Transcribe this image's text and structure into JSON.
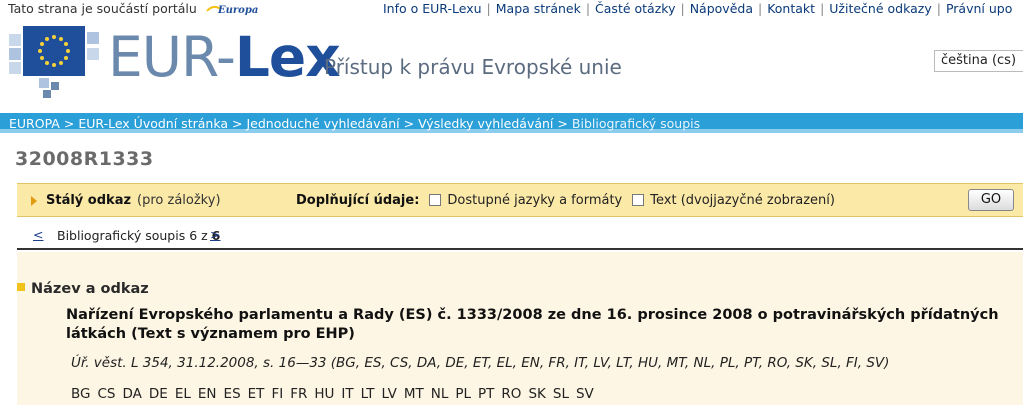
{
  "topbar": {
    "portal_text": "Tato strana je součástí portálu",
    "portal_logo": "Europa",
    "links": [
      "Info o EUR-Lexu",
      "Mapa stránek",
      "Časté otázky",
      "Nápověda",
      "Kontakt",
      "Užitečné odkazy",
      "Právní upo"
    ]
  },
  "header": {
    "logo_eur": "EUR-",
    "logo_lex": "Lex",
    "tagline": "Přístup k právu Evropské unie",
    "language": "čeština (cs)",
    "flag_color": "#1f4f9a",
    "star_color": "#f6d23a"
  },
  "breadcrumb": {
    "items": [
      "EUROPA",
      "EUR-Lex Úvodní stránka",
      "Jednoduché vyhledávání",
      "Výsledky vyhledávání",
      "Bibliografický soupis"
    ],
    "bar_color": "#2b9fd8"
  },
  "document": {
    "id": "32008R1333"
  },
  "options": {
    "permalink_label": "Stálý odkaz",
    "permalink_note": "(pro záložky)",
    "extra_label": "Doplňující údaje:",
    "option1": "Dostupné jazyky a formáty",
    "option2": "Text (dvojjazyčné zobrazení)",
    "go_label": "GO"
  },
  "pager": {
    "prev": "<",
    "info_prefix": "Bibliografický soupis 6 z ",
    "info_total": "6",
    "next": ">"
  },
  "content": {
    "section_title": "Název a odkaz",
    "title": "Nařízení Evropského parlamentu a Rady (ES) č. 1333/2008 ze dne 16. prosince 2008 o potravinářských přídatných látkách (Text s významem pro EHP)",
    "oj_reference": "Úř. věst. L 354, 31.12.2008, s. 16—33 (BG, ES, CS, DA, DE, ET, EL, EN, FR, IT, LV, LT, HU, MT, NL, PL, PT, RO, SK, SL, FI, SV)",
    "languages": [
      "BG",
      "CS",
      "DA",
      "DE",
      "EL",
      "EN",
      "ES",
      "ET",
      "FI",
      "FR",
      "HU",
      "IT",
      "LT",
      "LV",
      "MT",
      "NL",
      "PL",
      "PT",
      "RO",
      "SK",
      "SL",
      "SV"
    ]
  }
}
